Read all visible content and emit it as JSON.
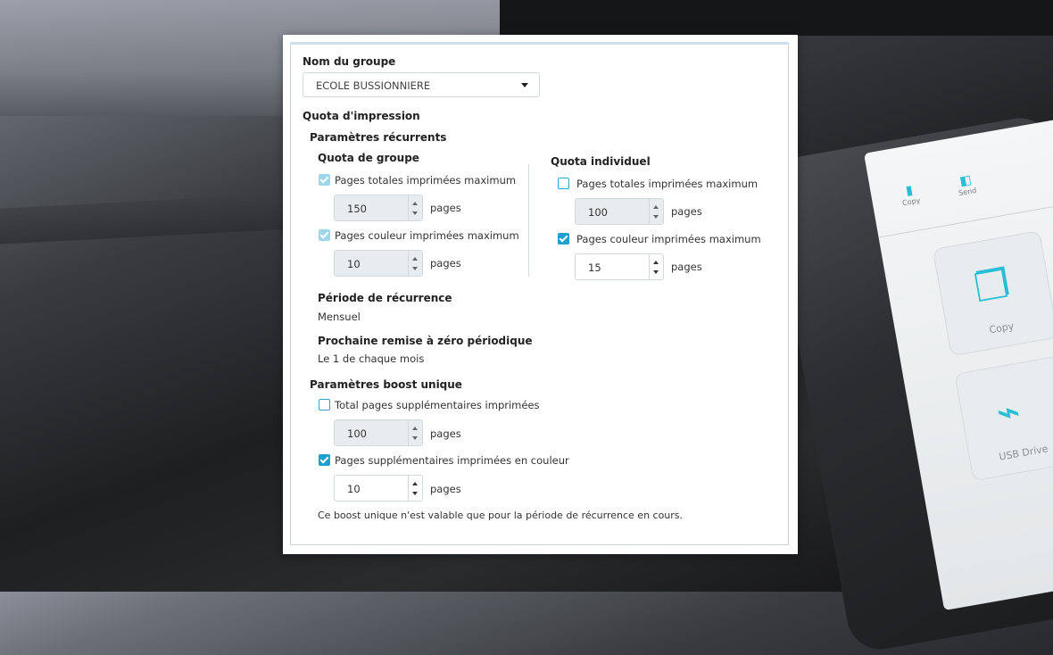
{
  "background": {
    "device": {
      "tabs": [
        "Copy",
        "Send"
      ],
      "tiles": [
        {
          "label": "Copy",
          "icon": "copy-icon"
        },
        {
          "label": "USB Drive",
          "icon": "usb-icon"
        }
      ]
    }
  },
  "form": {
    "group_label": "Nom du groupe",
    "group_value": "ECOLE BUSSIONNIERE",
    "quota_title": "Quota d'impression",
    "recurring_title": "Paramètres récurrents",
    "group_quota": {
      "title": "Quota de groupe",
      "total_label": "Pages totales imprimées maximum",
      "total_checked": true,
      "total_value": "150",
      "color_label": "Pages couleur imprimées maximum",
      "color_checked": true,
      "color_value": "10",
      "unit": "pages"
    },
    "individual_quota": {
      "title": "Quota individuel",
      "total_label": "Pages totales imprimées maximum",
      "total_checked": false,
      "total_value": "100",
      "color_label": "Pages couleur imprimées maximum",
      "color_checked": true,
      "color_value": "15",
      "unit": "pages"
    },
    "period_label": "Période de récurrence",
    "period_value": "Mensuel",
    "reset_label": "Prochaine remise à zéro périodique",
    "reset_value": "Le 1 de chaque mois",
    "boost_title": "Paramètres boost unique",
    "boost": {
      "total_label": "Total pages supplémentaires imprimées",
      "total_checked": false,
      "total_value": "100",
      "color_label": "Pages supplémentaires imprimées en couleur",
      "color_checked": true,
      "color_value": "10",
      "unit": "pages"
    },
    "note": "Ce boost unique n'est valable que pour la période de récurrence en cours."
  },
  "colors": {
    "accent": "#1e9fd0",
    "icon_teal": "#28bfd6"
  }
}
